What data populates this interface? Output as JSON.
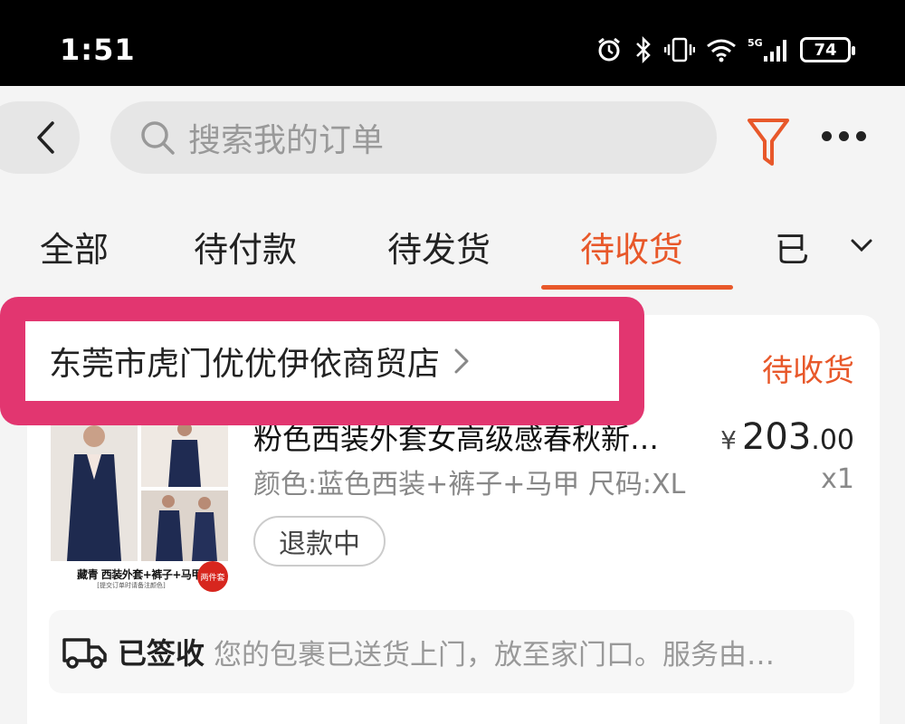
{
  "status_bar": {
    "time": "1:51",
    "icons": [
      "alarm-icon",
      "bluetooth-icon",
      "vibrate-icon",
      "wifi-icon",
      "signal-5g-icon"
    ],
    "battery": "74"
  },
  "header": {
    "search_placeholder": "搜索我的订单",
    "accent_color": "#e8582a"
  },
  "tabs": [
    {
      "label": "全部"
    },
    {
      "label": "待付款"
    },
    {
      "label": "待发货"
    },
    {
      "label": "待收货",
      "active": true
    },
    {
      "label": "已"
    }
  ],
  "order": {
    "shop_name": "东莞市虎门优优伊依商贸店",
    "status": "待收货",
    "product": {
      "title": "粉色西装外套女高级感春秋新…",
      "spec": "颜色:蓝色西装+裤子+马甲 尺码:XL",
      "price_currency": "¥",
      "price_int": "203",
      "price_dec": ".00",
      "quantity": "x1",
      "refund_label": "退款中",
      "image_caption": "藏青 西装外套+裤子+马甲",
      "image_subcaption": "[提交订单时请备注颜色]",
      "image_badge": "两件套"
    },
    "logistics": {
      "status": "已签收",
      "text": "您的包裹已送货上门，放至家门口。服务由…"
    }
  },
  "colors": {
    "highlight": "#e23670",
    "active_tab": "#e8582a"
  }
}
